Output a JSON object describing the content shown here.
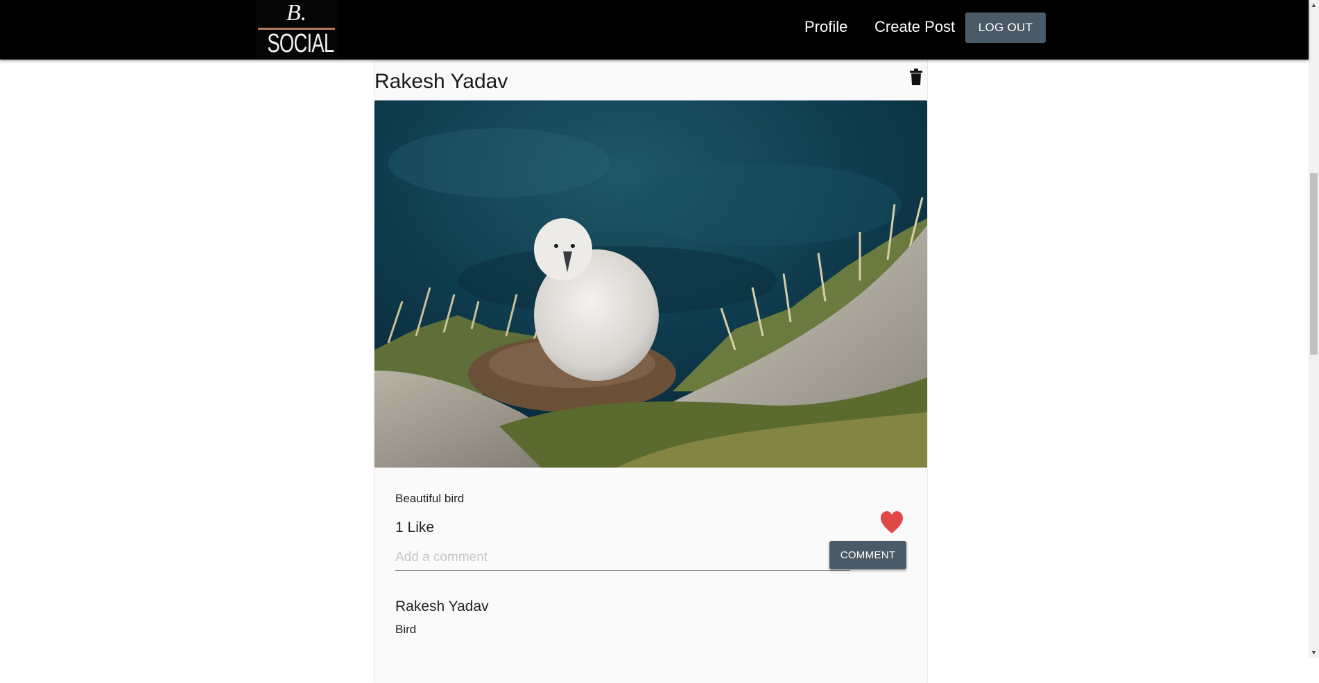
{
  "header": {
    "logo_letter": "B.",
    "logo_word": "SOCIAL",
    "nav": {
      "profile": "Profile",
      "create_post": "Create Post",
      "logout": "LOG OUT"
    }
  },
  "post": {
    "author": "Rakesh Yadav",
    "caption": "Beautiful bird",
    "likes": "1 Like",
    "liked": true,
    "comment_placeholder": "Add a comment",
    "comment_value": "",
    "comment_button": "COMMENT",
    "comments": [
      {
        "author": "Rakesh Yadav",
        "text": "Bird"
      }
    ]
  },
  "colors": {
    "navbar": "#000000",
    "button": "#4a5a67",
    "heart": "#e04848",
    "card": "#fafafa"
  },
  "icons": {
    "delete": "trash-icon",
    "like": "heart-icon"
  }
}
